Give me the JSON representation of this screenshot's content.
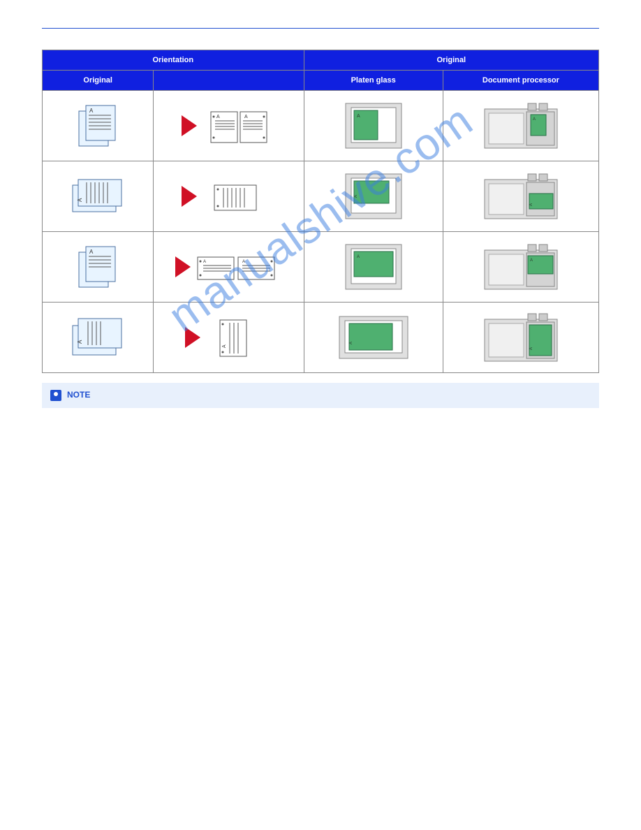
{
  "table": {
    "headers": {
      "orientation": "Orientation",
      "original": "Original",
      "output": "",
      "platen_glass": "Platen glass",
      "document_processor": "Document processor"
    }
  },
  "note": {
    "label": "NOTE",
    "body": ""
  },
  "watermark": "manualshive.com"
}
